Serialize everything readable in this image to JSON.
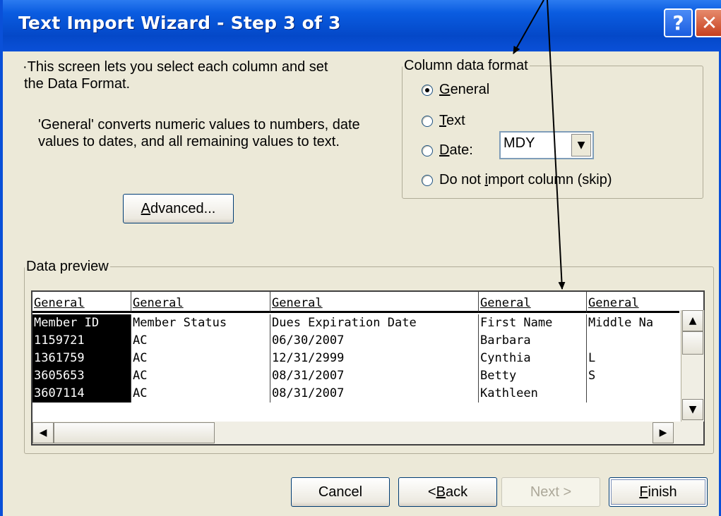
{
  "window": {
    "title": "Text Import Wizard - Step 3 of 3"
  },
  "titlebar": {
    "help_label": "?",
    "close_label": "✕"
  },
  "intro": {
    "line1": "This screen lets you select each column and set",
    "line2": "the Data Format.",
    "desc1": "'General' converts numeric values to numbers, date",
    "desc2": "values to dates, and all remaining values to text."
  },
  "column_format": {
    "legend": "Column data format",
    "options": [
      {
        "pre": "",
        "key": "G",
        "post": "eneral",
        "selected": true
      },
      {
        "pre": "",
        "key": "T",
        "post": "ext",
        "selected": false
      },
      {
        "pre": "",
        "key": "D",
        "post": "ate:",
        "selected": false
      },
      {
        "pre": "Do not ",
        "key": "i",
        "post": "mport column (skip)",
        "selected": false
      }
    ],
    "date_value": "MDY"
  },
  "advanced": {
    "pre": "",
    "key": "A",
    "post": "dvanced..."
  },
  "preview": {
    "legend": "Data preview",
    "headers": [
      "General",
      "General",
      "General",
      "General",
      "General"
    ],
    "columns": [
      "Member ID",
      "Member Status",
      "Dues Expiration Date",
      "First Name",
      "Middle Na"
    ],
    "rows": [
      [
        "1159721",
        "AC",
        "06/30/2007",
        "Barbara",
        ""
      ],
      [
        "1361759",
        "AC",
        "12/31/2999",
        "Cynthia",
        "L"
      ],
      [
        "3605653",
        "AC",
        "08/31/2007",
        "Betty",
        "S"
      ],
      [
        "3607114",
        "AC",
        "08/31/2007",
        "Kathleen",
        ""
      ]
    ]
  },
  "buttons": {
    "cancel": "Cancel",
    "back_pre": "< ",
    "back_key": "B",
    "back_post": "ack",
    "next": "Next >",
    "finish_key": "F",
    "finish_post": "inish"
  },
  "scroll": {
    "up": "▲",
    "down": "▼",
    "left": "◀",
    "right": "▶"
  },
  "colors": {
    "title_bar": "#0a50d8",
    "dialog_bg": "#ece9d8",
    "arrow": "#000000"
  }
}
